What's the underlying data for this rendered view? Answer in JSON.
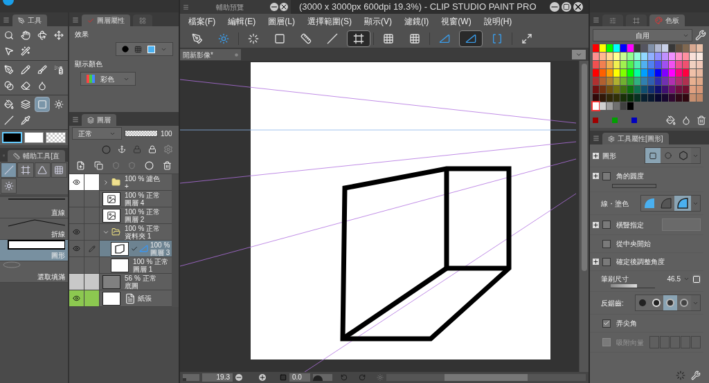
{
  "title_bar": {
    "title": "(3000 x 3000px 600dpi 19.3%)  - CLIP STUDIO PAINT PRO"
  },
  "preview_panel": {
    "title": "輔助預覽"
  },
  "menu": [
    "檔案(F)",
    "編輯(E)",
    "圖層(L)",
    "選擇範圍(S)",
    "顯示(V)",
    "濾鏡(I)",
    "視窗(W)",
    "說明(H)"
  ],
  "toolbar": [
    {
      "selected": false
    },
    {
      "selected": false
    },
    {
      "selected": false
    },
    {
      "selected": false
    },
    {
      "selected": false
    },
    {
      "selected": false
    },
    {
      "selected": true
    },
    {
      "selected": false
    },
    {
      "selected": false
    },
    {
      "selected": false
    },
    {
      "selected": true
    },
    {
      "selected": false
    },
    {
      "selected": false
    }
  ],
  "document_tab": {
    "label": "開新影像*"
  },
  "tool_panel": {
    "title": "工具",
    "tool_groups": [
      [
        {
          "selected": false
        },
        {
          "selected": false
        },
        {
          "selected": false
        },
        {
          "selected": false
        },
        {
          "selected": false
        },
        {
          "selected": false
        }
      ],
      [
        {
          "selected": false
        },
        {
          "selected": false
        },
        {
          "selected": false
        },
        {
          "selected": false
        },
        {
          "selected": false
        },
        {
          "selected": false
        },
        {
          "selected": false
        }
      ],
      [
        {
          "selected": false
        },
        {
          "selected": false
        },
        {
          "selected": true
        },
        {
          "selected": false
        },
        {
          "selected": false
        },
        {
          "selected": false
        }
      ]
    ],
    "colors": [
      {
        "kind": "solid",
        "color": "#000000",
        "selected": true
      },
      {
        "kind": "solid",
        "color": "#ffffff",
        "selected": false
      },
      {
        "kind": "transparent",
        "selected": false
      }
    ]
  },
  "sub_tool_panel": {
    "title": "輔助工具[直",
    "groups": [
      {
        "selected": true
      },
      {
        "selected": false
      },
      {
        "selected": false
      },
      {
        "selected": false
      },
      {
        "selected": false
      }
    ],
    "items": [
      {
        "label": "直線",
        "kind": "line",
        "selected": false
      },
      {
        "label": "折線",
        "kind": "polyline",
        "selected": false
      },
      {
        "label": "圖形",
        "kind": "shape",
        "selected": true
      },
      {
        "label": "選取填滿",
        "kind": "lasso",
        "selected": false
      }
    ]
  },
  "layer_property": {
    "tabs": [
      {
        "label": "圖層屬性",
        "selected": true
      },
      {
        "selected": false
      }
    ],
    "effect_label": "效果",
    "display_color_label": "顯示顏色",
    "display_color": "彩色"
  },
  "layers_panel": {
    "title": "圖層",
    "blend_mode": "正常",
    "opacity": "100",
    "opacity_slider": {
      "level": 1
    },
    "layers": [
      {
        "kind": "folder",
        "opacity": "100 %",
        "blend": "濾色",
        "name": "+",
        "visible": true,
        "expanded": false,
        "selected": false,
        "editing": false,
        "ruler": false,
        "color": "#ffffff"
      },
      {
        "kind": "raster",
        "opacity": "100 %",
        "blend": "正常",
        "name": "圖層 4",
        "visible": false,
        "selected": false,
        "editing": false,
        "ruler": false,
        "color": "#5e5e5e"
      },
      {
        "kind": "raster",
        "opacity": "100 %",
        "blend": "正常",
        "name": "圖層 2",
        "visible": false,
        "selected": false,
        "editing": false,
        "ruler": false,
        "color": "#5e5e5e"
      },
      {
        "kind": "folder",
        "opacity": "100 %",
        "blend": "正常",
        "name": "資料夾 1",
        "visible": true,
        "expanded": true,
        "selected": false,
        "editing": false,
        "ruler": false,
        "color": "#5e5e5e",
        "children": [
          {
            "kind": "vector",
            "opacity": "100 %",
            "name": "圖層 3",
            "visible": true,
            "selected": true,
            "editing": true,
            "ruler": true,
            "color": "#5e5e5e"
          },
          {
            "kind": "plain",
            "opacity": "100 %",
            "blend": "正常",
            "name": "圖層 1",
            "visible": false,
            "selected": false,
            "editing": false,
            "ruler": false,
            "color": "#5e5e5e"
          }
        ]
      },
      {
        "kind": "gray",
        "opacity": "56 %",
        "blend": "正常",
        "name": "底圖",
        "visible": false,
        "selected": false,
        "editing": false,
        "ruler": false,
        "color": "#c8c8c8"
      },
      {
        "kind": "paper",
        "name": "紙張",
        "visible": true,
        "selected": false,
        "editing": false,
        "ruler": false,
        "color": "#8cc850"
      }
    ]
  },
  "palette": {
    "tabs": [
      {
        "selected": false
      },
      {
        "selected": false
      },
      {
        "label": "色板",
        "selected": true
      }
    ],
    "set": "自用",
    "rows": [
      {
        "swatches": [
          {
            "color": "#ff0000"
          },
          {
            "color": "#ffff00"
          },
          {
            "color": "#00ff00"
          },
          {
            "color": "#00ffff"
          },
          {
            "color": "#0000ff"
          },
          {
            "color": "#ff00ff"
          },
          {
            "color": "#333333"
          },
          {
            "color": "#555560"
          },
          {
            "color": "#8090a8"
          },
          {
            "color": "#b0b8d0"
          },
          {
            "color": "#c8d0e8"
          },
          {
            "color": "#383838"
          },
          {
            "color": "#605040"
          },
          {
            "color": "#806850"
          },
          {
            "color": "#d8a890"
          },
          {
            "color": "#e8c0a8"
          }
        ]
      },
      {
        "swatches": [
          {
            "color": "#ff9090"
          },
          {
            "color": "#ffb890"
          },
          {
            "color": "#ffd890"
          },
          {
            "color": "#ffff90"
          },
          {
            "color": "#c8ff90"
          },
          {
            "color": "#90ff90"
          },
          {
            "color": "#90ffd8"
          },
          {
            "color": "#90d8ff"
          },
          {
            "color": "#90b0ff"
          },
          {
            "color": "#9090ff"
          },
          {
            "color": "#c090ff"
          },
          {
            "color": "#f090ff"
          },
          {
            "color": "#ff90c8"
          },
          {
            "color": "#ff90a0"
          },
          {
            "color": "#f8e0d8"
          },
          {
            "color": "#f8e8e0"
          }
        ]
      },
      {
        "swatches": [
          {
            "color": "#f05050"
          },
          {
            "color": "#f08050"
          },
          {
            "color": "#f0b050"
          },
          {
            "color": "#f0f050"
          },
          {
            "color": "#a0f050"
          },
          {
            "color": "#50f050"
          },
          {
            "color": "#50f0b0"
          },
          {
            "color": "#50b0f0"
          },
          {
            "color": "#5080f0"
          },
          {
            "color": "#5050f0"
          },
          {
            "color": "#a050f0"
          },
          {
            "color": "#f050f0"
          },
          {
            "color": "#f05090"
          },
          {
            "color": "#f05070"
          },
          {
            "color": "#f0d0c0"
          },
          {
            "color": "#f0c8b8"
          }
        ]
      },
      {
        "swatches": [
          {
            "color": "#ff0000"
          },
          {
            "color": "#ff6000"
          },
          {
            "color": "#ffa000"
          },
          {
            "color": "#ffff00"
          },
          {
            "color": "#80ff00"
          },
          {
            "color": "#00ff00"
          },
          {
            "color": "#00ffa0"
          },
          {
            "color": "#00a0ff"
          },
          {
            "color": "#0060ff"
          },
          {
            "color": "#0000ff"
          },
          {
            "color": "#8000ff"
          },
          {
            "color": "#ff00ff"
          },
          {
            "color": "#ff0080"
          },
          {
            "color": "#ff0040"
          },
          {
            "color": "#f0c0a8"
          },
          {
            "color": "#e8b8a0"
          }
        ]
      },
      {
        "swatches": [
          {
            "color": "#b03030"
          },
          {
            "color": "#b06030"
          },
          {
            "color": "#b08030"
          },
          {
            "color": "#b0b030"
          },
          {
            "color": "#70b030"
          },
          {
            "color": "#30b030"
          },
          {
            "color": "#30b080"
          },
          {
            "color": "#3080b0"
          },
          {
            "color": "#3060b0"
          },
          {
            "color": "#3030b0"
          },
          {
            "color": "#7030b0"
          },
          {
            "color": "#b030b0"
          },
          {
            "color": "#b03070"
          },
          {
            "color": "#b03050"
          },
          {
            "color": "#e8b090"
          },
          {
            "color": "#e0a888"
          }
        ]
      },
      {
        "swatches": [
          {
            "color": "#701010"
          },
          {
            "color": "#703010"
          },
          {
            "color": "#705010"
          },
          {
            "color": "#707010"
          },
          {
            "color": "#407010"
          },
          {
            "color": "#107010"
          },
          {
            "color": "#107050"
          },
          {
            "color": "#105070"
          },
          {
            "color": "#103070"
          },
          {
            "color": "#101070"
          },
          {
            "color": "#401070"
          },
          {
            "color": "#701070"
          },
          {
            "color": "#701040"
          },
          {
            "color": "#701030"
          },
          {
            "color": "#e0a080"
          },
          {
            "color": "#d89878"
          }
        ]
      },
      {
        "swatches": [
          {
            "color": "#300808"
          },
          {
            "color": "#301808"
          },
          {
            "color": "#302808"
          },
          {
            "color": "#303008"
          },
          {
            "color": "#183008"
          },
          {
            "color": "#083008"
          },
          {
            "color": "#083020"
          },
          {
            "color": "#082030"
          },
          {
            "color": "#081830"
          },
          {
            "color": "#080830"
          },
          {
            "color": "#180830"
          },
          {
            "color": "#300830"
          },
          {
            "color": "#300818"
          },
          {
            "color": "#300810"
          },
          {
            "color": "#c89070"
          },
          {
            "color": "#c08868"
          }
        ]
      }
    ],
    "extra": [
      {
        "color": "#ffffff",
        "selected": true
      },
      {
        "color": "#d0d0d0",
        "selected": false
      },
      {
        "color": "#a0a0a0",
        "selected": false
      },
      {
        "color": "#707070",
        "selected": false
      },
      {
        "color": "#404040",
        "selected": false
      },
      {
        "color": "#000000",
        "selected": false
      }
    ],
    "recent": [
      {
        "color": "#a00000"
      },
      {
        "color": "#00a000"
      },
      {
        "color": "#0000c0"
      }
    ]
  },
  "tool_property": {
    "title": "工具屬性[圖形]",
    "rows": [
      {
        "kind": "shape",
        "label": "圖形",
        "options": [
          {
            "selected": true
          },
          {
            "selected": false
          },
          {
            "selected": false
          }
        ]
      },
      {
        "kind": "checkbox",
        "label": "角的圓度",
        "checked": false,
        "disabled": false,
        "expandable": true,
        "bar": true,
        "level": 0
      },
      {
        "kind": "fill",
        "label": "線・塗色",
        "options": [
          {
            "selected": false
          },
          {
            "selected": false
          },
          {
            "selected": true
          }
        ]
      },
      {
        "kind": "checkbox",
        "label": "橫豎指定",
        "checked": false,
        "disabled": false,
        "expandable": true,
        "bar": false
      },
      {
        "kind": "checkbox",
        "label": "從中央開始",
        "checked": false,
        "disabled": false,
        "expandable": false,
        "bar": false
      },
      {
        "kind": "checkbox",
        "label": "確定後調整角度",
        "checked": false,
        "disabled": false,
        "expandable": true,
        "bar": false
      },
      {
        "kind": "slider",
        "label": "筆刷尺寸",
        "value": "46.5",
        "level": 0.6
      },
      {
        "kind": "antialias",
        "label": "反鋸齒:",
        "options": [
          {
            "selected": false
          },
          {
            "selected": false
          },
          {
            "selected": true
          },
          {
            "selected": false
          }
        ]
      },
      {
        "kind": "checkbox",
        "label": "弄尖角",
        "checked": true,
        "disabled": false,
        "expandable": false,
        "bar": false
      },
      {
        "kind": "checkbox",
        "label": "吸附向量",
        "checked": false,
        "disabled": true,
        "expandable": false,
        "bar": false
      }
    ]
  },
  "status_bar": {
    "zoom_slider": {
      "level": 0.2
    },
    "zoom": "19.3",
    "angle": "0.0",
    "rotation_slider": {
      "level": 0.5
    }
  }
}
